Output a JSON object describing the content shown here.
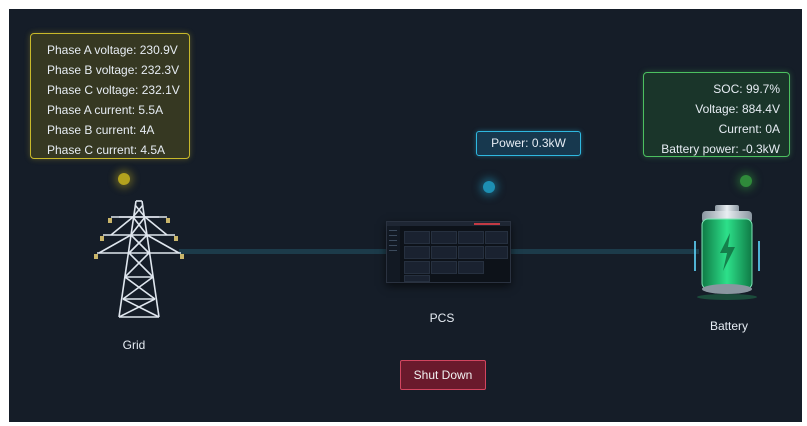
{
  "grid": {
    "lines": [
      "Phase A voltage: 230.9V",
      "Phase B voltage: 232.3V",
      "Phase C voltage: 232.1V",
      "Phase A current: 5.5A",
      "Phase B current: 4A",
      "Phase C current: 4.5A"
    ],
    "label": "Grid"
  },
  "pcs": {
    "power": "Power: 0.3kW",
    "label": "PCS"
  },
  "battery": {
    "lines": [
      "SOC: 99.7%",
      "Voltage: 884.4V",
      "Current: 0A",
      "Battery power: -0.3kW"
    ],
    "label": "Battery"
  },
  "actions": {
    "shutdown": "Shut Down"
  },
  "colors": {
    "grid_accent": "#c8b82a",
    "pcs_accent": "#2fb8e0",
    "battery_accent": "#4cc060",
    "shutdown_accent": "#d2455f",
    "panel_background": "#151d28"
  },
  "icons": {
    "grid": "transmission-tower-icon",
    "pcs": "pcs-screen-icon",
    "battery": "battery-charging-icon"
  }
}
